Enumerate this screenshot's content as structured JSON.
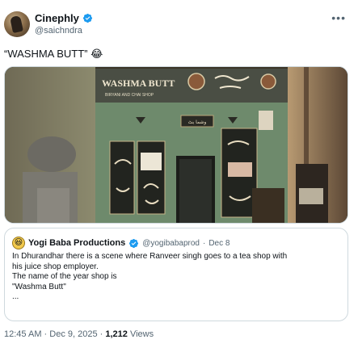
{
  "author": {
    "name": "Cinephly",
    "handle": "@saichndra",
    "verified_color": "#1d9bf0"
  },
  "tweet": {
    "text": "“WASHMA BUTT” 😂"
  },
  "media": {
    "sign_title": "WASHMA BUTT",
    "sign_subtitle": "BIRYANI AND CHAI SHOP",
    "door_plate": "وشما بٹ"
  },
  "quote": {
    "name": "Yogi Baba Productions",
    "avatar_icon": "😃",
    "handle": "@yogibabaprod",
    "separator": "·",
    "date": "Dec 8",
    "lines": [
      "In Dhurandhar there is a scene where Ranveer singh goes to a tea shop with",
      "his juice shop employer.",
      "The name of the year shop is",
      "\"Washma Butt\"",
      "..."
    ]
  },
  "meta": {
    "timestamp": "12:45 AM · Dec 9, 2025 · ",
    "views_count": "1,212",
    "views_label": " Views"
  }
}
